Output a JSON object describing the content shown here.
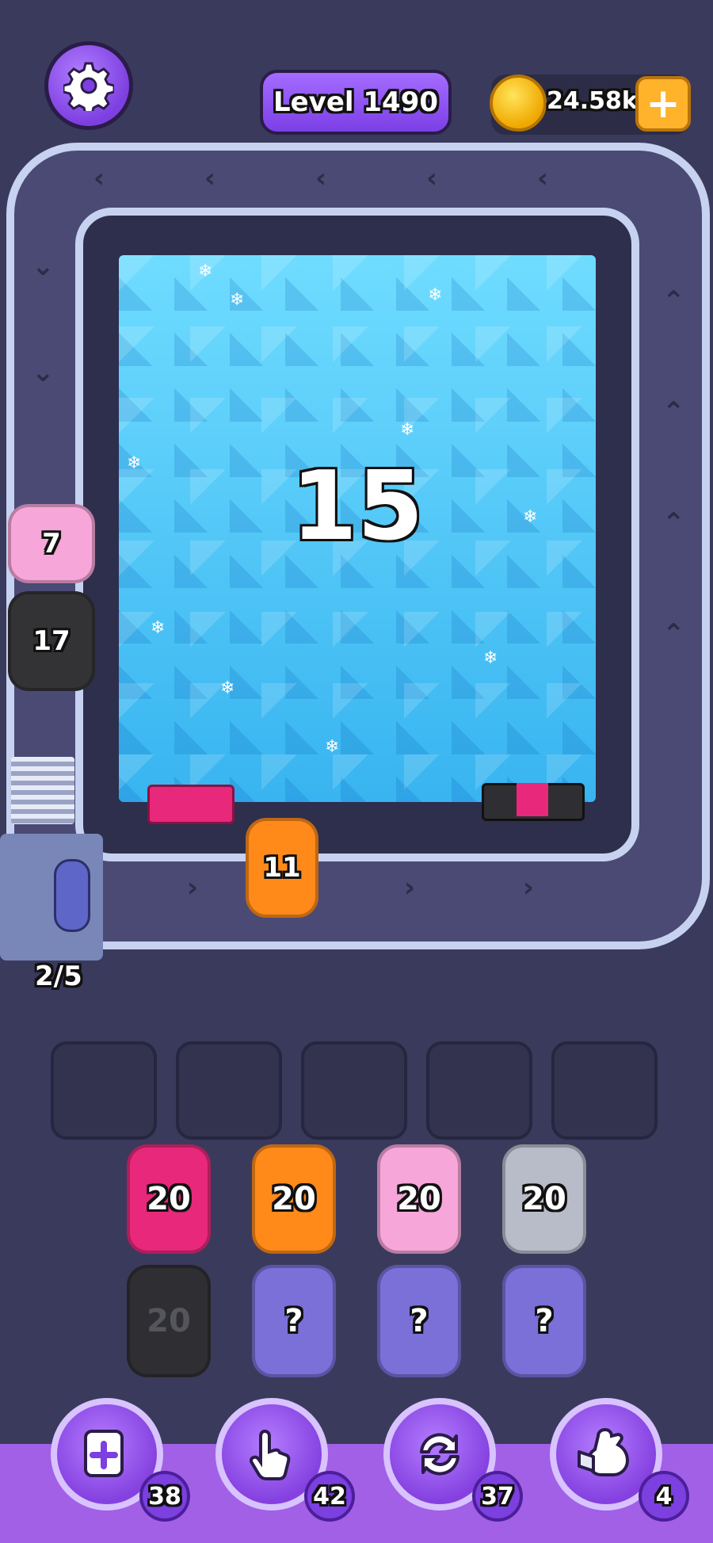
{
  "header": {
    "level_label": "Level 1490",
    "coins": "24.58k",
    "coin_plus": "+"
  },
  "board": {
    "ice_count": "15",
    "queue_counter": "2/5",
    "track_items": [
      {
        "color": "#f6a6d8",
        "count": "7"
      },
      {
        "color": "#333336",
        "count": "17"
      },
      {
        "color": "#ff8a1a",
        "count": "11"
      }
    ]
  },
  "buffer_slots": 5,
  "grid": [
    {
      "color": "#e8287a",
      "label": "20",
      "hidden": false
    },
    {
      "color": "#ff8a1a",
      "label": "20",
      "hidden": false
    },
    {
      "color": "#f6a6d8",
      "label": "20",
      "hidden": false
    },
    {
      "color": "#b8bcc8",
      "label": "20",
      "hidden": false
    },
    {
      "color": "#2f2f33",
      "label": "20",
      "hidden": false
    },
    {
      "color": "#7a70d8",
      "label": "?",
      "hidden": true
    },
    {
      "color": "#7a70d8",
      "label": "?",
      "hidden": true
    },
    {
      "color": "#7a70d8",
      "label": "?",
      "hidden": true
    }
  ],
  "tools": [
    {
      "icon": "add-slot-icon",
      "count": "38"
    },
    {
      "icon": "tap-hand-icon",
      "count": "42"
    },
    {
      "icon": "shuffle-icon",
      "count": "37"
    },
    {
      "icon": "vacuum-icon",
      "count": "4"
    }
  ]
}
